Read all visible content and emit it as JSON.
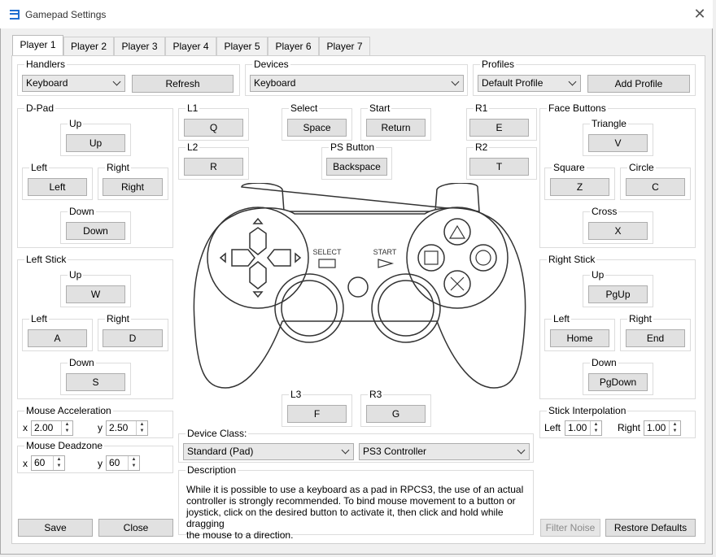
{
  "window": {
    "title": "Gamepad Settings"
  },
  "tabs": [
    "Player 1",
    "Player 2",
    "Player 3",
    "Player 4",
    "Player 5",
    "Player 6",
    "Player 7"
  ],
  "handlers": {
    "label": "Handlers",
    "value": "Keyboard",
    "refresh": "Refresh"
  },
  "devices": {
    "label": "Devices",
    "value": "Keyboard"
  },
  "profiles": {
    "label": "Profiles",
    "value": "Default Profile",
    "add": "Add Profile"
  },
  "dpad": {
    "label": "D-Pad",
    "up_label": "Up",
    "up": "Up",
    "left_label": "Left",
    "left": "Left",
    "right_label": "Right",
    "right": "Right",
    "down_label": "Down",
    "down": "Down"
  },
  "left_stick": {
    "label": "Left Stick",
    "up_label": "Up",
    "up": "W",
    "left_label": "Left",
    "left": "A",
    "right_label": "Right",
    "right": "D",
    "down_label": "Down",
    "down": "S"
  },
  "shoulder": {
    "l1_label": "L1",
    "l1": "Q",
    "l2_label": "L2",
    "l2": "R",
    "r1_label": "R1",
    "r1": "E",
    "r2_label": "R2",
    "r2": "T"
  },
  "center": {
    "select_label": "Select",
    "select": "Space",
    "start_label": "Start",
    "start": "Return",
    "ps_label": "PS Button",
    "ps": "Backspace"
  },
  "sticks_click": {
    "l3_label": "L3",
    "l3": "F",
    "r3_label": "R3",
    "r3": "G"
  },
  "face": {
    "label": "Face Buttons",
    "triangle_label": "Triangle",
    "triangle": "V",
    "square_label": "Square",
    "square": "Z",
    "circle_label": "Circle",
    "circle": "C",
    "cross_label": "Cross",
    "cross": "X"
  },
  "right_stick": {
    "label": "Right Stick",
    "up_label": "Up",
    "up": "PgUp",
    "left_label": "Left",
    "left": "Home",
    "right_label": "Right",
    "right": "End",
    "down_label": "Down",
    "down": "PgDown"
  },
  "gamepad_image": {
    "select_text": "SELECT",
    "start_text": "START"
  },
  "mouse_accel": {
    "label": "Mouse Acceleration",
    "x_label": "x",
    "x": "2.00",
    "y_label": "y",
    "y": "2.50"
  },
  "mouse_deadzone": {
    "label": "Mouse Deadzone",
    "x_label": "x",
    "x": "60",
    "y_label": "y",
    "y": "60"
  },
  "stick_interp": {
    "label": "Stick Interpolation",
    "left_label": "Left",
    "left": "1.00",
    "right_label": "Right",
    "right": "1.00"
  },
  "device_class": {
    "label": "Device Class:",
    "class_value": "Standard (Pad)",
    "type_value": "PS3 Controller"
  },
  "description": {
    "label": "Description",
    "lines": [
      "While it is possible to use a keyboard as a pad in RPCS3, the use of an actual",
      "controller is strongly recommended. To bind mouse movement to a button or",
      "joystick, click on the desired button to activate it, then click and hold while dragging",
      "the mouse to a direction."
    ]
  },
  "footer": {
    "save": "Save",
    "close": "Close",
    "filter_noise": "Filter Noise",
    "restore": "Restore Defaults"
  }
}
